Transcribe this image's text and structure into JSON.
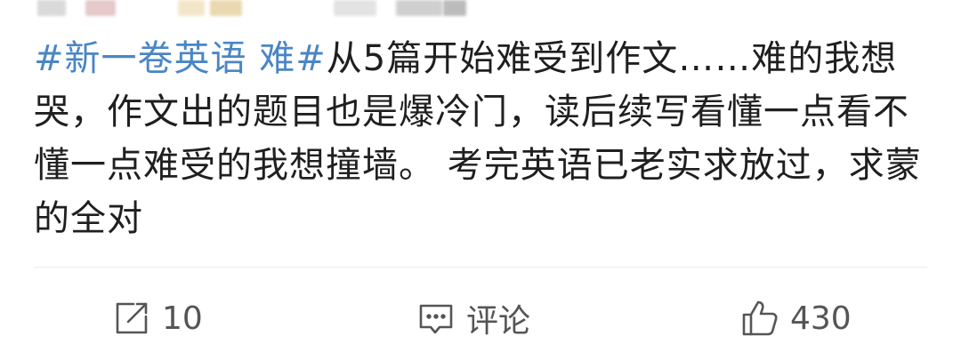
{
  "post": {
    "hashtag": "#新一卷英语 难#",
    "body": "从5篇开始难受到作文……难的我想哭，作文出的题目也是爆冷门，读后续写看懂一点看不懂一点难受的我想撞墙。 考完英语已老实求放过，求蒙的全对"
  },
  "actions": {
    "repost": {
      "icon": "repost-icon",
      "label": "10"
    },
    "comment": {
      "icon": "comment-icon",
      "label": "评论"
    },
    "like": {
      "icon": "thumbs-up-icon",
      "label": "430"
    }
  },
  "colors": {
    "hashtag": "#4a86c5",
    "text": "#1f1f1f",
    "action_text": "#555555"
  }
}
